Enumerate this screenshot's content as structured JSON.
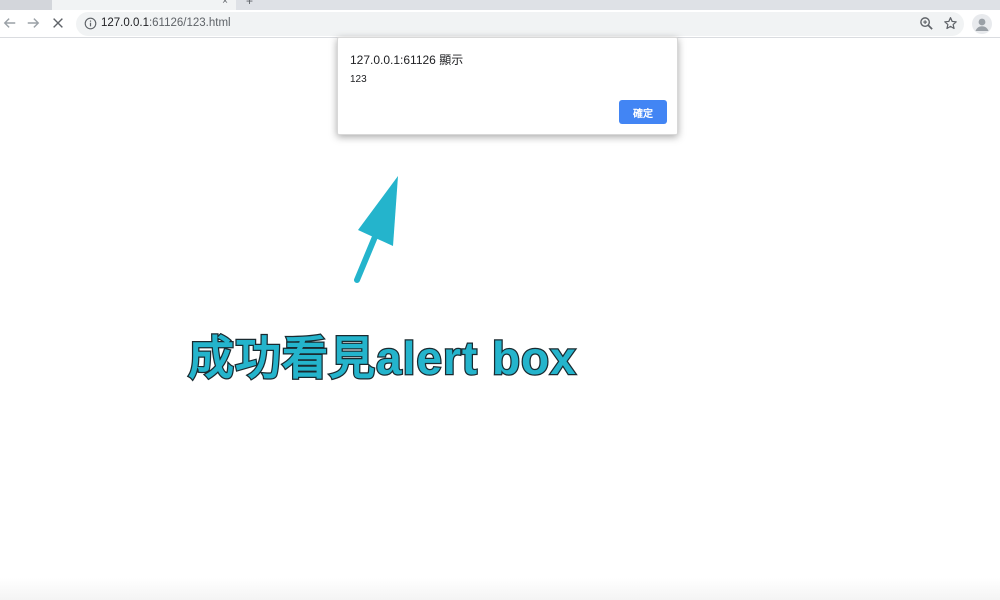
{
  "browser": {
    "tabs": [
      {
        "title": ""
      },
      {
        "title": "",
        "close": "×"
      }
    ],
    "new_tab": "+",
    "address": {
      "host": "127.0.0.1",
      "rest": ":61126/123.html"
    }
  },
  "dialog": {
    "title": "127.0.0.1:61126 顯示",
    "message": "123",
    "ok_label": "確定"
  },
  "annotation": {
    "caption": "成功看見alert box",
    "color": "#24b4cc"
  },
  "colors": {
    "ok_button": "#4285f4"
  }
}
